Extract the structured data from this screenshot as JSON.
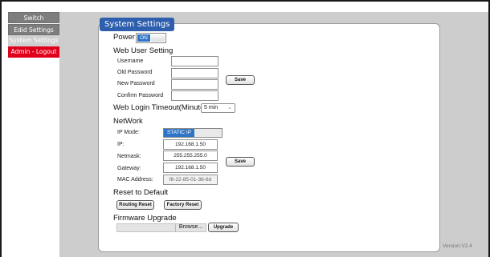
{
  "sidebar": {
    "items": [
      {
        "label": "Switch"
      },
      {
        "label": "Edid Settings"
      },
      {
        "label": "System Settings"
      },
      {
        "label": "Admin - Logout"
      }
    ]
  },
  "panel": {
    "title": "System Settings"
  },
  "power": {
    "label": "Power",
    "toggle": "ON"
  },
  "web_user": {
    "title": "Web User Setting",
    "username_label": "Username",
    "old_password_label": "Old Password",
    "new_password_label": "New Password",
    "confirm_password_label": "Confirm Password",
    "save_label": "Save"
  },
  "timeout": {
    "label": "Web Login Timeout(Minute)",
    "value": "5 min"
  },
  "network": {
    "title": "NetWork",
    "ip_mode_label": "IP Mode:",
    "ip_mode_value": "STATIC IP",
    "ip_label": "IP:",
    "ip_value": "192.168.1.50",
    "netmask_label": "Netmask:",
    "netmask_value": "255.255.255.0",
    "gateway_label": "Gateway:",
    "gateway_value": "192.168.1.50",
    "mac_label": "MAC Address:",
    "mac_value": "f8-22-85-01-36-8d",
    "save_label": "Save"
  },
  "reset": {
    "title": "Reset to Default",
    "routing_label": "Routing Reset",
    "factory_label": "Factory Reset"
  },
  "firmware": {
    "title": "Firmware Upgrade",
    "browse_label": "Browse...",
    "upgrade_label": "Upgrade"
  },
  "version": "Version:V2.4",
  "colors": {
    "accent": "#2e5fae",
    "toggle_on": "#2f75c7",
    "logout": "#e0001b",
    "panel_bg": "#cdcdcd"
  }
}
